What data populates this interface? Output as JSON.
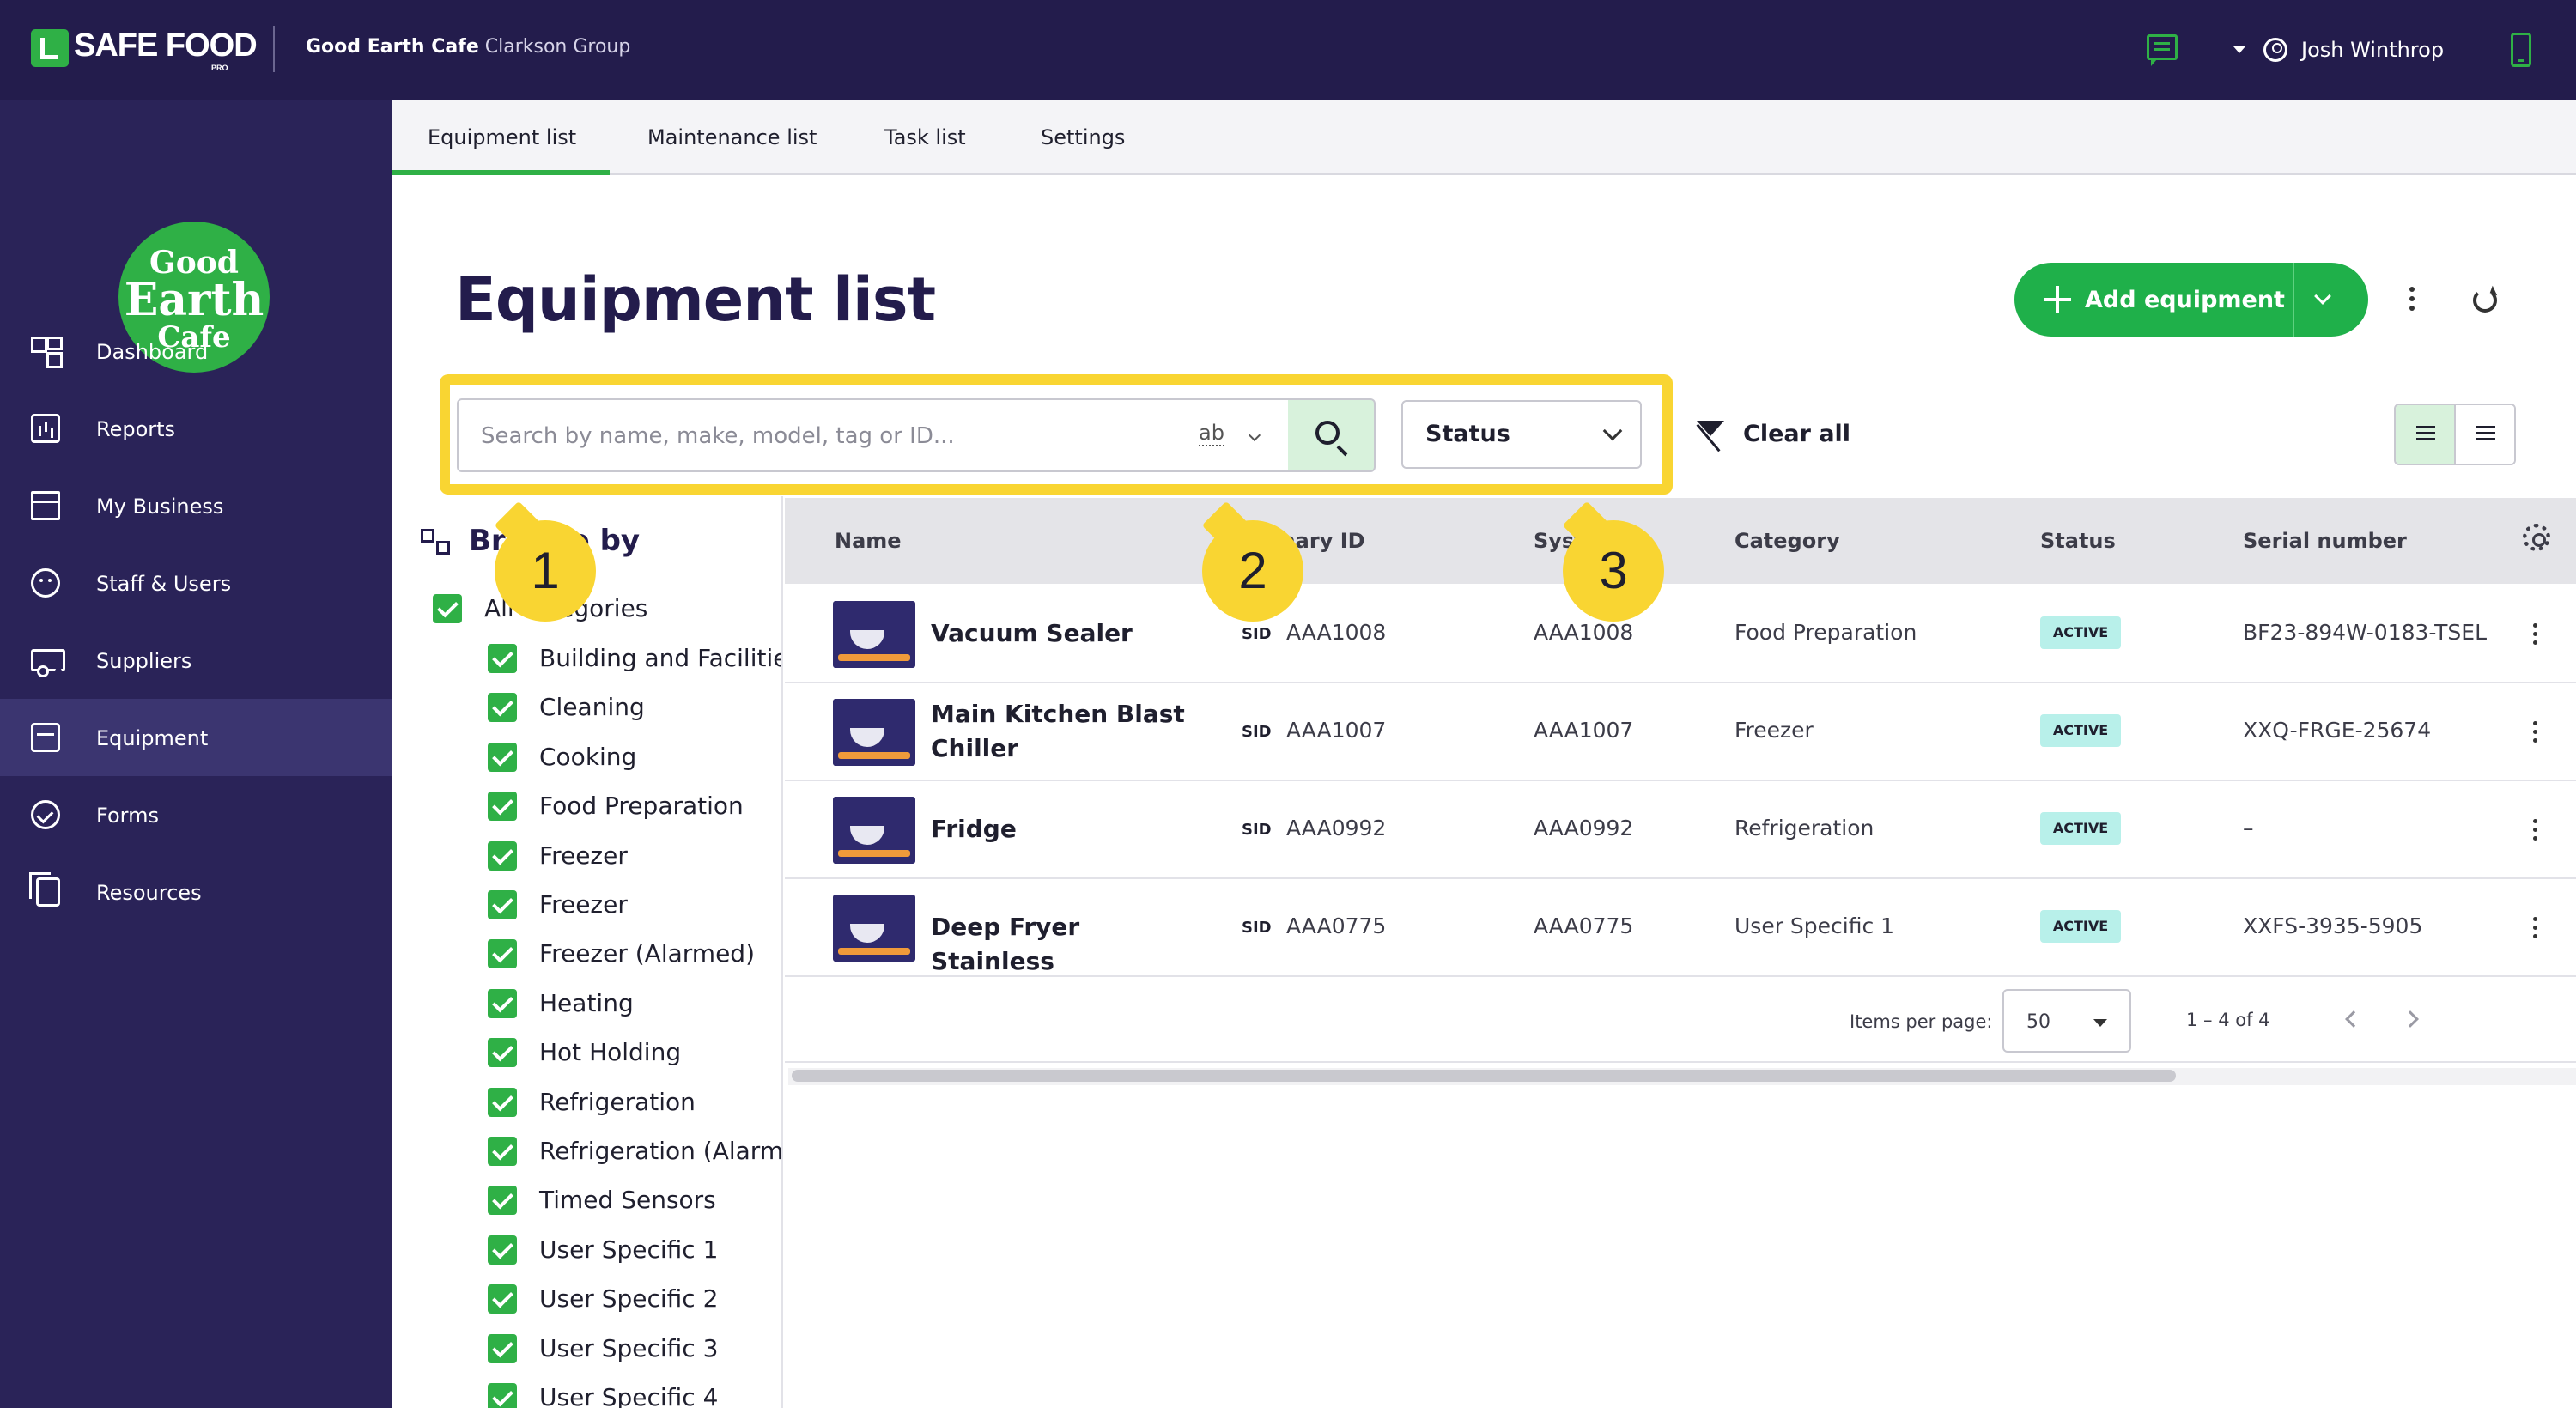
{
  "topbar": {
    "brand": "SAFE FOOD",
    "brand_tier": "PRO",
    "org_primary": "Good Earth Cafe",
    "org_secondary": "Clarkson Group",
    "user_name": "Josh Winthrop"
  },
  "sidebar": {
    "brand_logo": {
      "line1": "Good",
      "line2": "Earth",
      "line3": "Cafe"
    },
    "items": [
      {
        "label": "Dashboard",
        "icon": "dashboard-icon"
      },
      {
        "label": "Reports",
        "icon": "reports-icon"
      },
      {
        "label": "My Business",
        "icon": "business-icon"
      },
      {
        "label": "Staff & Users",
        "icon": "staff-icon"
      },
      {
        "label": "Suppliers",
        "icon": "truck-icon"
      },
      {
        "label": "Equipment",
        "icon": "equipment-icon",
        "active": true
      },
      {
        "label": "Forms",
        "icon": "check-circle-icon"
      },
      {
        "label": "Resources",
        "icon": "copy-icon"
      }
    ]
  },
  "tabs": [
    {
      "label": "Equipment list",
      "active": true
    },
    {
      "label": "Maintenance list"
    },
    {
      "label": "Task list"
    },
    {
      "label": "Settings"
    }
  ],
  "header": {
    "title": "Equipment list",
    "add_button": "Add equipment"
  },
  "filters": {
    "search_placeholder": "Search by name, make, model, tag or ID...",
    "search_mode": "ab",
    "status_label": "Status",
    "clear_all": "Clear all"
  },
  "browse": {
    "title": "Browse by",
    "all_label": "All categories",
    "categories": [
      "Building and Facilities",
      "Cleaning",
      "Cooking",
      "Food Preparation",
      "Freezer",
      "Freezer",
      "Freezer (Alarmed)",
      "Heating",
      "Hot Holding",
      "Refrigeration",
      "Refrigeration (Alarmed)",
      "Timed Sensors",
      "User Specific 1",
      "User Specific 2",
      "User Specific 3",
      "User Specific 4"
    ]
  },
  "table": {
    "columns": [
      "Name",
      "Primary ID",
      "System ID",
      "Category",
      "Status",
      "Serial number"
    ],
    "sid_tag": "SID",
    "rows": [
      {
        "name": "Vacuum Sealer",
        "primary_id": "AAA1008",
        "system_id": "AAA1008",
        "category": "Food Preparation",
        "status": "ACTIVE",
        "serial": "BF23-894W-0183-TSEL"
      },
      {
        "name": "Main Kitchen Blast Chiller",
        "primary_id": "AAA1007",
        "system_id": "AAA1007",
        "category": "Freezer",
        "status": "ACTIVE",
        "serial": "XXQ-FRGE-25674"
      },
      {
        "name": "Fridge",
        "primary_id": "AAA0992",
        "system_id": "AAA0992",
        "category": "Refrigeration",
        "status": "ACTIVE",
        "serial": "–"
      },
      {
        "name": "Deep Fryer Stainless",
        "primary_id": "AAA0775",
        "system_id": "AAA0775",
        "category": "User Specific 1",
        "status": "ACTIVE",
        "serial": "XXFS-3935-5905"
      }
    ]
  },
  "pagination": {
    "items_per_page_label": "Items per page:",
    "items_per_page": "50",
    "range": "1 – 4 of 4"
  },
  "callouts": [
    "1",
    "2",
    "3"
  ],
  "colors": {
    "topbar_bg": "#231c4c",
    "sidebar_bg": "#2a2358",
    "accent_green": "#1fb04a",
    "highlight_yellow": "#f9d532",
    "status_active_bg": "#b8f0ea"
  }
}
